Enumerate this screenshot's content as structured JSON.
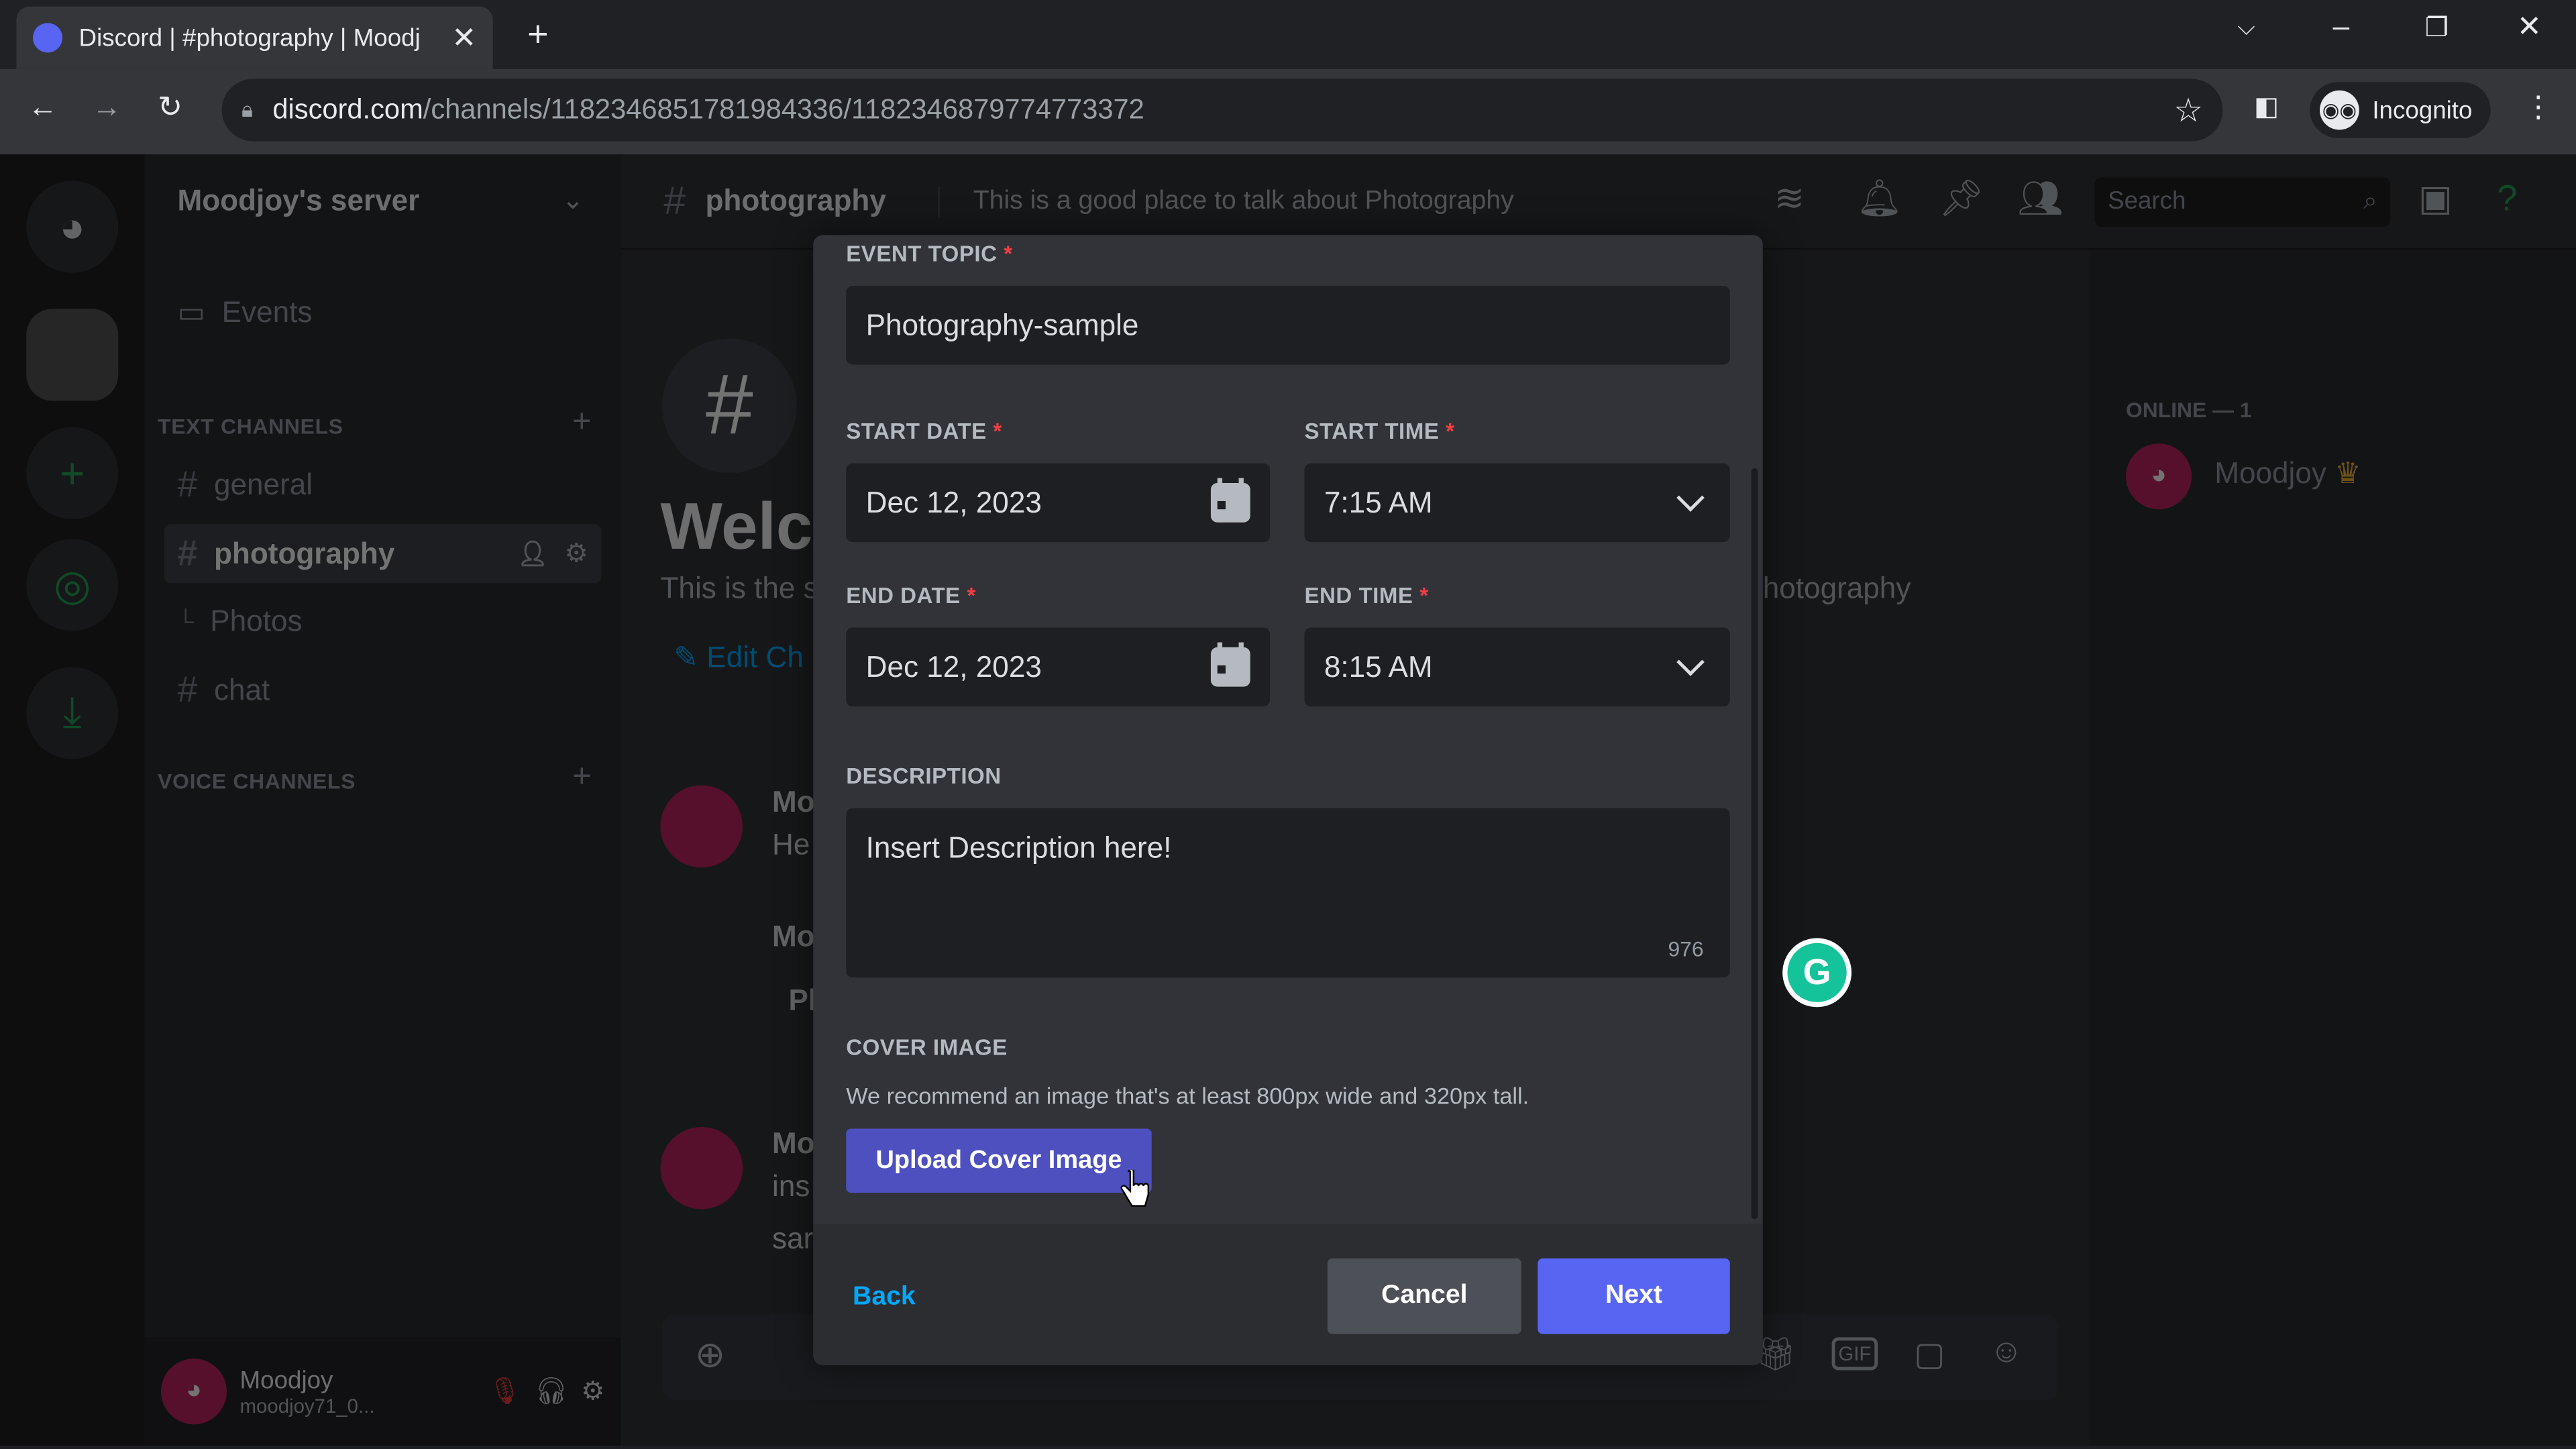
{
  "browser": {
    "tab_title": "Discord | #photography | Moodj",
    "url_host": "discord.com",
    "url_path": "/channels/1182346851781984336/1182346879774773372",
    "profile_label": "Incognito"
  },
  "sidebar": {
    "server_name": "Moodjoy's server",
    "events_label": "Events",
    "text_category": "TEXT CHANNELS",
    "voice_category": "VOICE CHANNELS",
    "channels": [
      {
        "name": "general"
      },
      {
        "name": "photography"
      },
      {
        "name": "Photos"
      },
      {
        "name": "chat"
      }
    ],
    "user": {
      "name": "Moodjoy",
      "tag": "moodjoy71_0..."
    }
  },
  "header": {
    "channel": "photography",
    "topic": "This is a good place to talk about Photography",
    "search_placeholder": "Search"
  },
  "main": {
    "welcome": "Welco",
    "welcome_sub": "This is the s",
    "edit_channel": "Edit Ch",
    "topic_tail": "hotography",
    "messages": [
      {
        "author": "Mo",
        "text": "He"
      },
      {
        "author": "Mo",
        "text": "Pl"
      },
      {
        "author": "Mo",
        "text": "ins",
        "text2": "sar"
      }
    ]
  },
  "members": {
    "online_header": "ONLINE — 1",
    "member_name": "Moodjoy"
  },
  "modal": {
    "event_topic_label": "EVENT TOPIC",
    "event_topic_value": "Photography-sample",
    "start_date_label": "START DATE",
    "start_date_value": "Dec 12, 2023",
    "start_time_label": "START TIME",
    "start_time_value": "7:15 AM",
    "end_date_label": "END DATE",
    "end_date_value": "Dec 12, 2023",
    "end_time_label": "END TIME",
    "end_time_value": "8:15 AM",
    "description_label": "DESCRIPTION",
    "description_value": "Insert Description here!",
    "char_count": "976",
    "cover_label": "COVER IMAGE",
    "cover_hint": "We recommend an image that's at least 800px wide and 320px tall.",
    "upload_label": "Upload Cover Image",
    "back_label": "Back",
    "cancel_label": "Cancel",
    "next_label": "Next",
    "required_mark": "*"
  },
  "colors": {
    "brand": "#5865f2",
    "link": "#00a8fc",
    "required": "#f23f43",
    "grammarly": "#15c39a"
  }
}
